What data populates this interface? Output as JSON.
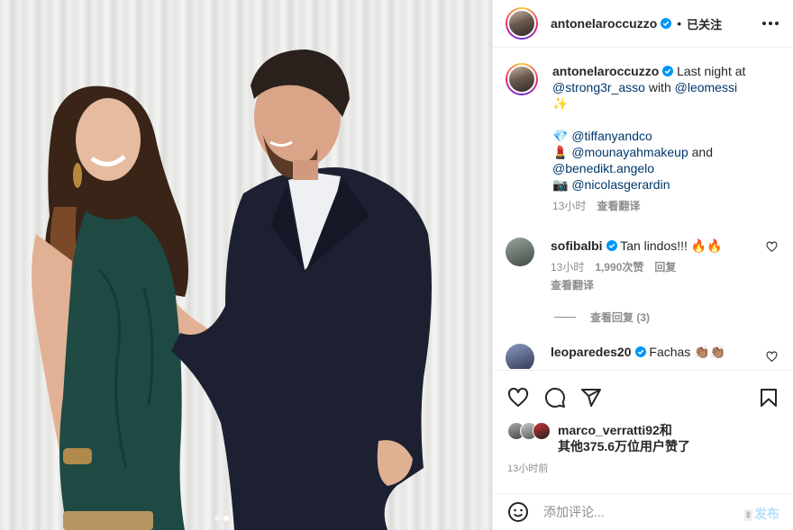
{
  "post": {
    "author": "antonelaroccuzzo",
    "follow_status": "已关注",
    "separator": "•",
    "caption": {
      "text_1": "Last night at",
      "mention_1": "@strong3r_asso",
      "text_2": "with",
      "mention_2": "@leomessi",
      "sparkle": "✨",
      "gem": "💎",
      "mention_3": "@tiffanyandco",
      "lipstick": "💄",
      "mention_4": "@mounayahmakeup",
      "text_3": "and",
      "mention_5": "@benedikt.angelo",
      "camera": "📷",
      "mention_6": "@nicolasgerardin",
      "time": "13小时",
      "translate": "查看翻译"
    },
    "comments": [
      {
        "username": "sofibalbi",
        "text": "Tan lindos!!! 🔥🔥",
        "time": "13小时",
        "likes": "1,990次赞",
        "reply": "回复",
        "translate": "查看翻译"
      },
      {
        "username": "leoparedes20",
        "text": "Fachas 👏🏽👏🏽"
      }
    ],
    "view_replies": "查看回复 (3)",
    "liked_by": "marco_verratti92和",
    "liked_others": "其他375.6万位用户赞了",
    "timestamp": "13小时前",
    "comment_placeholder": "添加评论...",
    "post_button": "发布"
  },
  "icons": [
    "verified-icon",
    "more-icon",
    "heart-icon",
    "comment-icon",
    "share-icon",
    "bookmark-icon",
    "emoji-icon"
  ],
  "colors": {
    "link": "#00376b",
    "verified": "#0095f6",
    "muted": "#8e8e8e",
    "post_disabled": "#b2dffc",
    "dress": "#1f4a44",
    "suit": "#1c2030"
  },
  "carousel": {
    "total": 2,
    "active": 2
  }
}
